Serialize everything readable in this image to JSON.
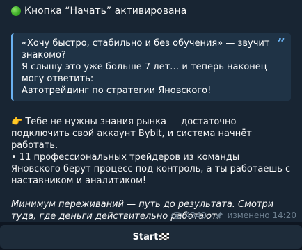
{
  "message": {
    "headline": "Кнопка “Начать” активирована",
    "quote": {
      "line1": "«Хочу быстро, стабильно и без обучения» — звучит знакомо?",
      "line2": "Я слышу это уже больше 7 лет… и теперь наконец могу ответить:",
      "line3": "Автотрейдинг по стратегии Яновского!"
    },
    "paragraph1": "👉 Тебе не нужны знания рынка — достаточно подключить свой аккаунт Bybit, и система начнёт работать.",
    "paragraph2": "• 11 профессиональных трейдеров из команды Яновского берут процесс под контроль, а ты работаешь с наставником и аналитиком!",
    "italic": "Минимум переживаний — путь до результата. Смотри туда, где деньги действительно работают.",
    "views": "4340",
    "edited": "изменено 14:20"
  },
  "button": {
    "label": "Start"
  },
  "icons": {
    "status": "green-circle-icon",
    "quote": "quote-mark-icon",
    "views": "eye-icon",
    "pinned": "pin-icon",
    "flag": "checkered-flag-icon"
  },
  "colors": {
    "background": "#0e1621",
    "bubble": "#182533",
    "quote_bar": "#6ab2f2",
    "meta_text": "#6d7f8f",
    "button": "#1e2c3a"
  }
}
